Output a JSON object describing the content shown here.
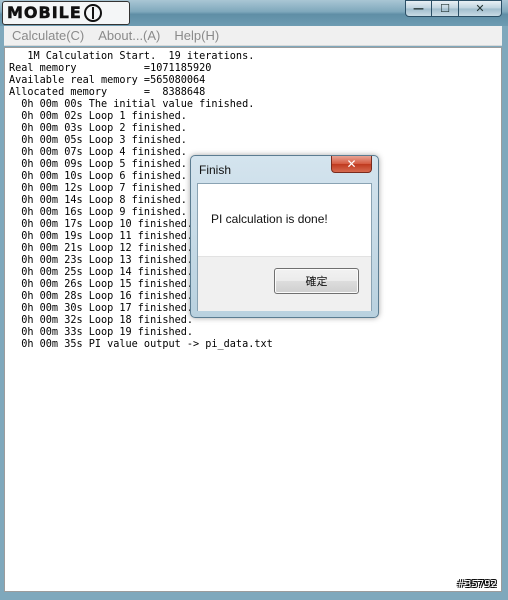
{
  "window": {
    "logo_text": "MOBILE",
    "minimize_glyph": "—",
    "maximize_glyph": "☐",
    "close_glyph": "✕"
  },
  "menu": [
    {
      "label": "Calculate(C)"
    },
    {
      "label": "About...(A)"
    },
    {
      "label": "Help(H)"
    }
  ],
  "log_lines": [
    "   1M Calculation Start.  19 iterations.",
    "Real memory           =1071185920",
    "Available real memory =565080064",
    "Allocated memory      =  8388648",
    "  0h 00m 00s The initial value finished.",
    "  0h 00m 02s Loop 1 finished.",
    "  0h 00m 03s Loop 2 finished.",
    "  0h 00m 05s Loop 3 finished.",
    "  0h 00m 07s Loop 4 finished.",
    "  0h 00m 09s Loop 5 finished.",
    "  0h 00m 10s Loop 6 finished.",
    "  0h 00m 12s Loop 7 finished.",
    "  0h 00m 14s Loop 8 finished.",
    "  0h 00m 16s Loop 9 finished.",
    "  0h 00m 17s Loop 10 finished.",
    "  0h 00m 19s Loop 11 finished.",
    "  0h 00m 21s Loop 12 finished.",
    "  0h 00m 23s Loop 13 finished.",
    "  0h 00m 25s Loop 14 finished.",
    "  0h 00m 26s Loop 15 finished.",
    "  0h 00m 28s Loop 16 finished.",
    "  0h 00m 30s Loop 17 finished.",
    "  0h 00m 32s Loop 18 finished.",
    "  0h 00m 33s Loop 19 finished.",
    "  0h 00m 35s PI value output -> pi_data.txt"
  ],
  "dialog": {
    "title": "Finish",
    "close_glyph": "✕",
    "message": "PI calculation is done!",
    "ok_label": "確定"
  },
  "watermark": "#35792",
  "colors": {
    "titlebar": "#7fa8bc",
    "dialog_close": "#d4593f",
    "menu_text_disabled": "#8a8a8a"
  }
}
